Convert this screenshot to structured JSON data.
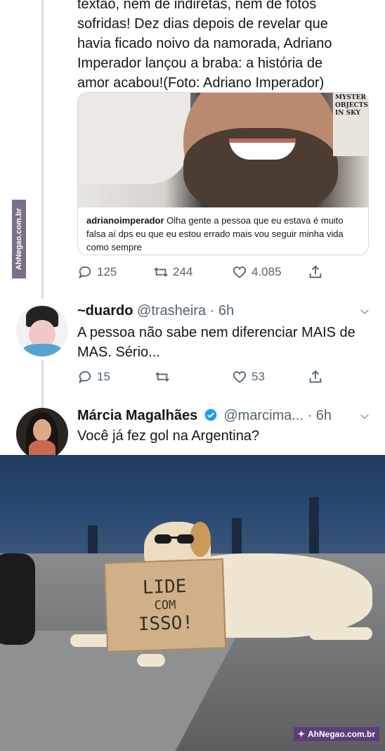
{
  "watermark": {
    "text": "AhNegao.com.br"
  },
  "tweet": {
    "text_lines": [
      "textão, nem de indiretas, nem de fotos",
      "sofridas! Dez dias depois de revelar que",
      "havia ficado noivo da namorada, Adriano",
      "Imperador lançou a braba: a história de",
      "amor acabou!(Foto: Adriano Imperador)"
    ],
    "card": {
      "book_text": "MYSTER OBJECTS IN SKY",
      "caption_user": "adrianoimperador",
      "caption_text": " Olha gente a pessoa que eu estava é muito falsa aí dps eu que eu estou errado mais vou seguir minha vida como sempre"
    },
    "actions": {
      "replies": "125",
      "retweets": "244",
      "likes": "4.085"
    }
  },
  "reply1": {
    "name": "~duardo",
    "handle": "@trasheira · 6h",
    "text": "A pessoa não sabe nem diferenciar MAIS de MAS. Sério...",
    "actions": {
      "replies": "15",
      "likes": "53"
    }
  },
  "reply2": {
    "name": "Márcia Magalhães",
    "handle": "@marcima... · 6h",
    "text": "Você já fez gol na Argentina?"
  },
  "meme": {
    "sign_lines": [
      "LIDE",
      "COM",
      "ISSO!"
    ]
  },
  "colors": {
    "accent": "#1d9bf0",
    "muted": "#536471",
    "watermark": "#5b3f7a"
  }
}
